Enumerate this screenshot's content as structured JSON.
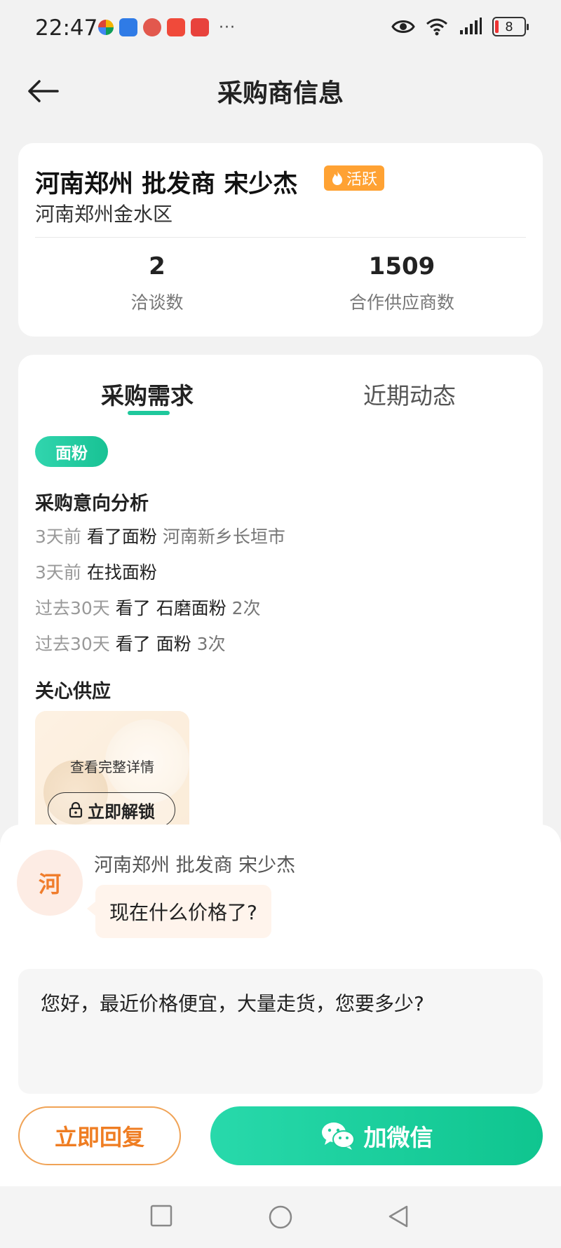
{
  "status_bar": {
    "time": "22:47",
    "more": "···",
    "battery": "8",
    "app_icon_colors": [
      "#3aa7f0",
      "#2f7be6",
      "#e2584d",
      "#f04a3a",
      "#e8423c"
    ]
  },
  "header": {
    "title": "采购商信息"
  },
  "buyer": {
    "name": "河南郑州 批发商 宋少杰",
    "badge": "活跃",
    "address": "河南郑州金水区",
    "stats": [
      {
        "value": "2",
        "label": "洽谈数"
      },
      {
        "value": "1509",
        "label": "合作供应商数"
      }
    ]
  },
  "tabs": [
    {
      "label": "采购需求",
      "active": true
    },
    {
      "label": "近期动态",
      "active": false
    }
  ],
  "demand": {
    "tag": "面粉",
    "intent_title": "采购意向分析",
    "intents": [
      {
        "when": "3天前",
        "action": "看了面粉",
        "extra": "河南新乡长垣市"
      },
      {
        "when": "3天前",
        "action": "在找面粉",
        "extra": ""
      },
      {
        "when": "过去30天",
        "action": "看了 石磨面粉",
        "extra": "2次"
      },
      {
        "when": "过去30天",
        "action": "看了 面粉",
        "extra": "3次"
      }
    ],
    "supply_title": "关心供应",
    "supply_card": {
      "see_details": "查看完整详情",
      "unlock": "立即解锁"
    }
  },
  "message": {
    "avatar_char": "河",
    "sender": "河南郑州 批发商 宋少杰",
    "text": "现在什么价格了?",
    "reply_draft": "您好，最近价格便宜，大量走货，您要多少?"
  },
  "actions": {
    "reply": "立即回复",
    "wechat": "加微信"
  },
  "colors": {
    "accent_green": "#1fc89c",
    "accent_orange": "#ef7d22",
    "badge_orange": "#ffa233"
  },
  "icons": {
    "back": "back-arrow-icon",
    "fire": "fire-icon",
    "lock": "lock-icon",
    "wechat": "wechat-icon"
  }
}
